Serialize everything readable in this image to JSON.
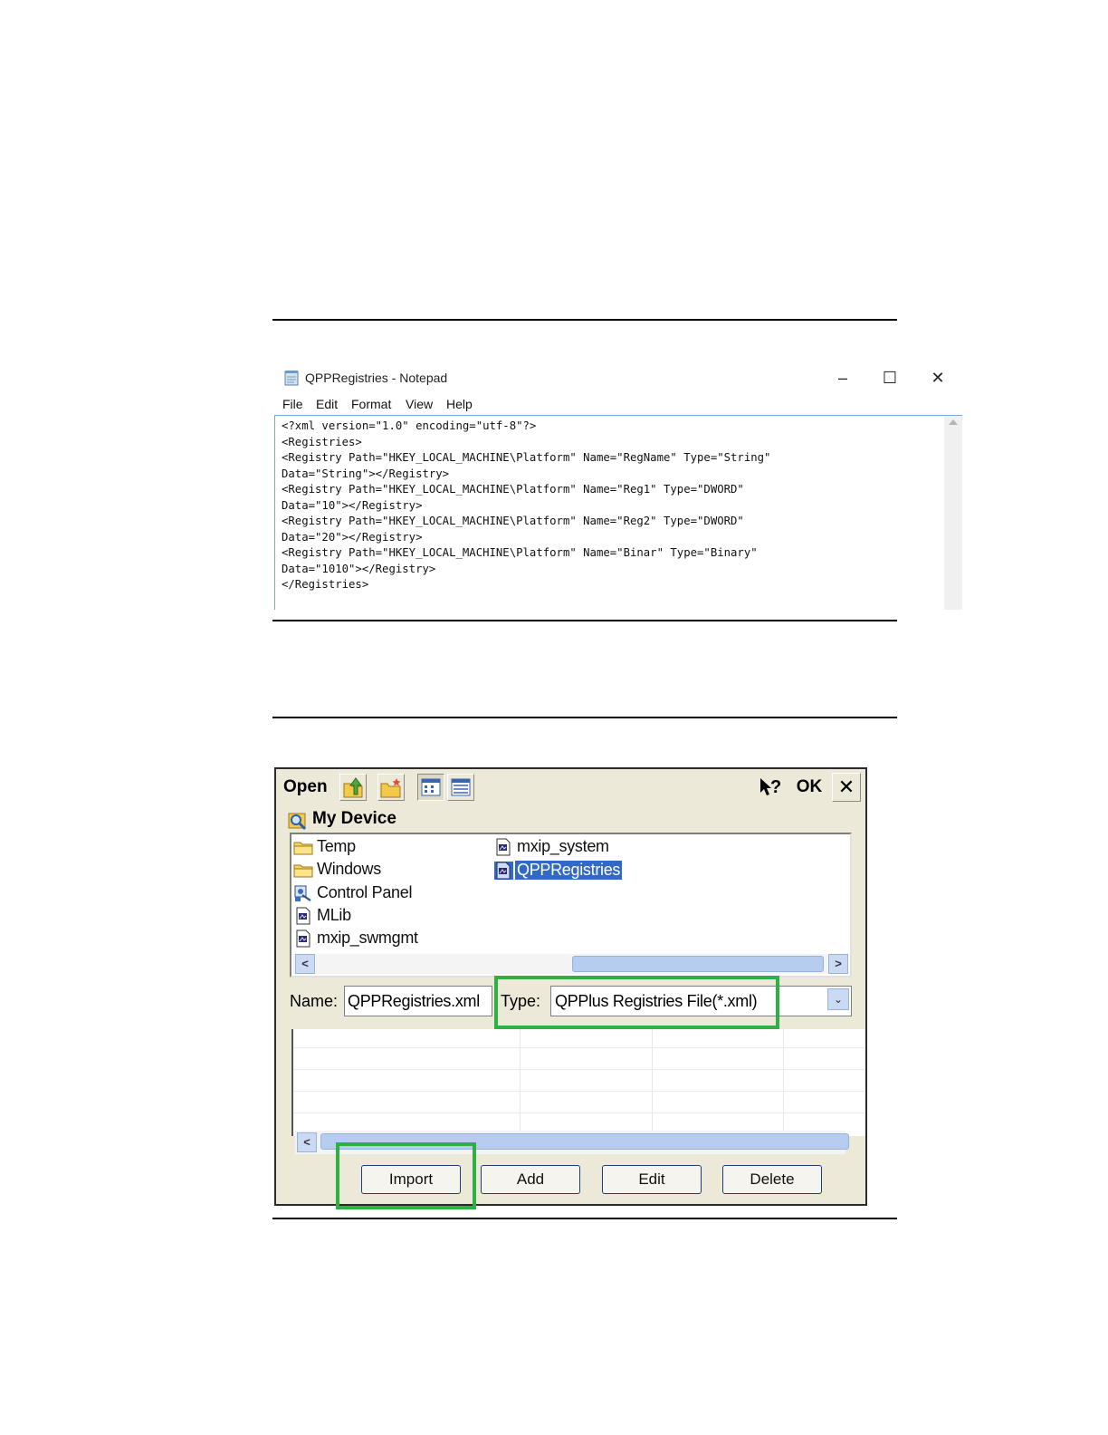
{
  "notepad": {
    "title": "QPPRegistries - Notepad",
    "window_controls": {
      "minimize": "–",
      "maximize": "☐",
      "close": "✕"
    },
    "menu": [
      "File",
      "Edit",
      "Format",
      "View",
      "Help"
    ],
    "content_lines": [
      "<?xml version=\"1.0\" encoding=\"utf-8\"?>",
      "<Registries>",
      "<Registry Path=\"HKEY_LOCAL_MACHINE\\Platform\" Name=\"RegName\" Type=\"String\"",
      "Data=\"String\"></Registry>",
      "<Registry Path=\"HKEY_LOCAL_MACHINE\\Platform\" Name=\"Reg1\" Type=\"DWORD\"",
      "Data=\"10\"></Registry>",
      "<Registry Path=\"HKEY_LOCAL_MACHINE\\Platform\" Name=\"Reg2\" Type=\"DWORD\"",
      "Data=\"20\"></Registry>",
      "<Registry Path=\"HKEY_LOCAL_MACHINE\\Platform\" Name=\"Binar\" Type=\"Binary\"",
      "Data=\"1010\"></Registry>",
      "</Registries>"
    ]
  },
  "open_dialog": {
    "title": "Open",
    "help_label": "?",
    "ok_label": "OK",
    "close_label": "✕",
    "location": "My Device",
    "files": [
      {
        "label": "Temp",
        "icon": "folder-icon",
        "selected": false
      },
      {
        "label": "Windows",
        "icon": "folder-icon",
        "selected": false
      },
      {
        "label": "Control Panel",
        "icon": "control-panel-icon",
        "selected": false
      },
      {
        "label": "MLib",
        "icon": "document-icon",
        "selected": false
      },
      {
        "label": "mxip_swmgmt",
        "icon": "document-icon",
        "selected": false
      },
      {
        "label": "mxip_system",
        "icon": "document-icon",
        "selected": false
      },
      {
        "label": "QPPRegistries",
        "icon": "document-icon",
        "selected": true
      }
    ],
    "name_label": "Name:",
    "name_value": "QPPRegistries.xml",
    "type_label": "Type:",
    "type_value": "QPPlus Registries File(*.xml)",
    "scroll_left": "<",
    "scroll_right": ">",
    "dropdown_arrow": "⌄"
  },
  "buttons": {
    "import": "Import",
    "add": "Add",
    "edit": "Edit",
    "delete": "Delete"
  },
  "colors": {
    "highlight": "#2fb045",
    "selection": "#316ac5",
    "dialog_bg": "#ece9d8"
  }
}
